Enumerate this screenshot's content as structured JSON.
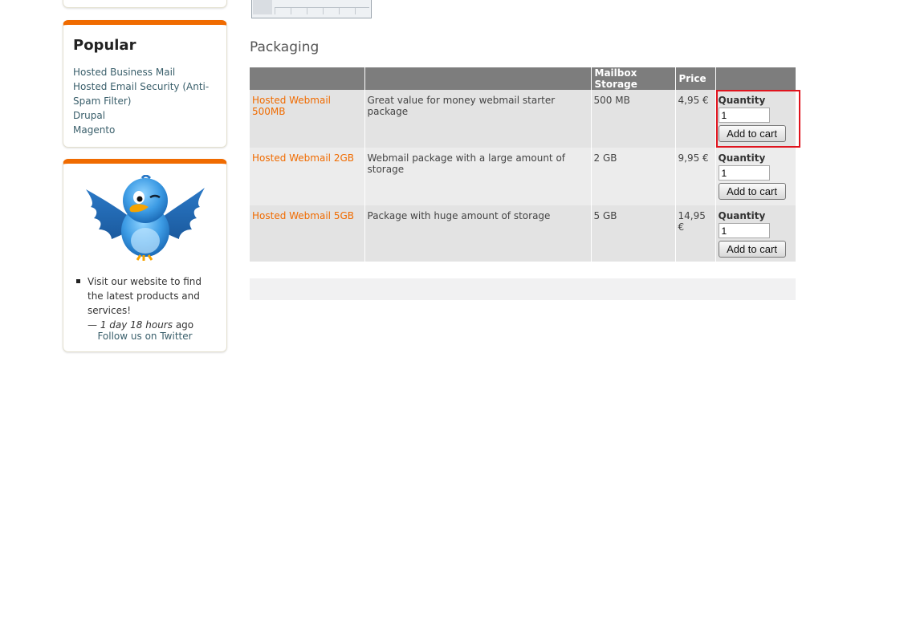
{
  "sidebar": {
    "popular": {
      "title": "Popular",
      "links": [
        "Hosted Business Mail",
        "Hosted Email Security (Anti-Spam Filter)",
        "Drupal",
        "Magento"
      ]
    },
    "twitter": {
      "tweet_text": "Visit our website to find the latest products and services!",
      "tweet_time": "1 day 18 hours",
      "tweet_prefix": "— ",
      "tweet_suffix": " ago",
      "follow_label": "Follow us on Twitter"
    }
  },
  "main": {
    "section_title": "Packaging",
    "table": {
      "headers": [
        "",
        "",
        "Mailbox Storage",
        "Price",
        ""
      ],
      "quantity_label": "Quantity",
      "add_to_cart_label": "Add to cart",
      "rows": [
        {
          "name": "Hosted Webmail 500MB",
          "description": "Great value for money webmail starter package",
          "storage": "500 MB",
          "price": "4,95 €",
          "quantity": "1"
        },
        {
          "name": "Hosted Webmail 2GB",
          "description": "Webmail package with a large amount of storage",
          "storage": "2 GB",
          "price": "9,95 €",
          "quantity": "1"
        },
        {
          "name": "Hosted Webmail 5GB",
          "description": "Package with huge amount of storage",
          "storage": "5 GB",
          "price": "14,95 €",
          "quantity": "1"
        }
      ]
    }
  },
  "colors": {
    "accent": "#f06b00",
    "header_bg": "#7d7d7d",
    "highlight": "#e0141e",
    "link": "#3a5f6b"
  }
}
